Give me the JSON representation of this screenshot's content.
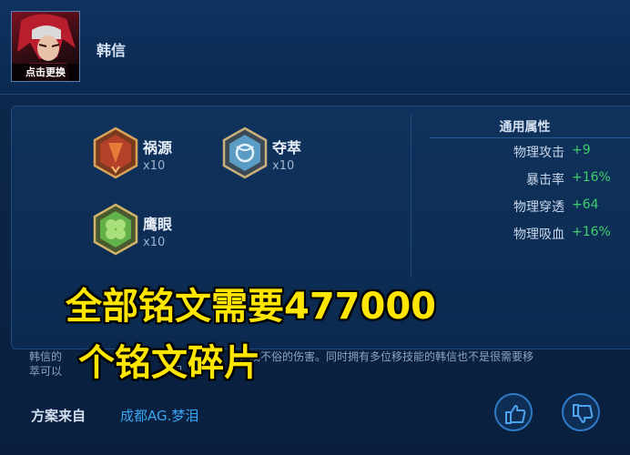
{
  "header": {
    "avatar_button": "点击更换",
    "hero_name": "韩信"
  },
  "inscriptions": [
    {
      "name": "祸源",
      "count": "x10",
      "icon": "red-inscription-icon",
      "color": "#c0452a"
    },
    {
      "name": "夺萃",
      "count": "x10",
      "icon": "blue-inscription-icon",
      "color": "#5aa0c8"
    },
    {
      "name": "鹰眼",
      "count": "x10",
      "icon": "green-inscription-icon",
      "color": "#5cab3c"
    }
  ],
  "attributes": {
    "title": "通用属性",
    "rows": [
      {
        "label": "物理攻击",
        "value": "+9"
      },
      {
        "label": "暴击率",
        "value": "+16%"
      },
      {
        "label": "物理穿透",
        "value": "+64"
      },
      {
        "label": "物理吸血",
        "value": "+16%"
      }
    ]
  },
  "description": {
    "line1": "韩信的",
    "line1_tail": "以造成不俗的伤害。同时拥有多位移技能的韩信也不是很需要移",
    "line2": "萃可以",
    "line2_tail": "回"
  },
  "source": {
    "label": "方案来自",
    "author": "成都AG.梦泪"
  },
  "overlay": {
    "line1": "全部铭文需要477000",
    "line2": "个铭文碎片"
  },
  "colors": {
    "accent_green": "#3fd06b",
    "accent_blue": "#3aa4f0",
    "overlay_yellow": "#ffe600"
  }
}
